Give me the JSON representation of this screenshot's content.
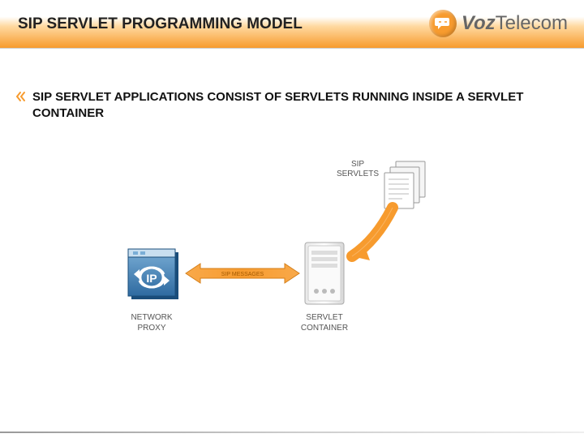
{
  "header": {
    "title": "SIP SERVLET PROGRAMMING MODEL",
    "logo_prefix": "Voz",
    "logo_suffix": "Telecom"
  },
  "bullet": {
    "text": "SIP SERVLET APPLICATIONS CONSIST OF SERVLETS RUNNING INSIDE A SERVLET CONTAINER"
  },
  "diagram": {
    "sip_servlets_label": "SIP SERVLETS",
    "sip_messages_label": "SIP MESSAGES",
    "network_proxy_label_l1": "NETWORK",
    "network_proxy_label_l2": "PROXY",
    "servlet_container_label_l1": "SERVLET",
    "servlet_container_label_l2": "CONTAINER",
    "ip_label": "IP"
  }
}
